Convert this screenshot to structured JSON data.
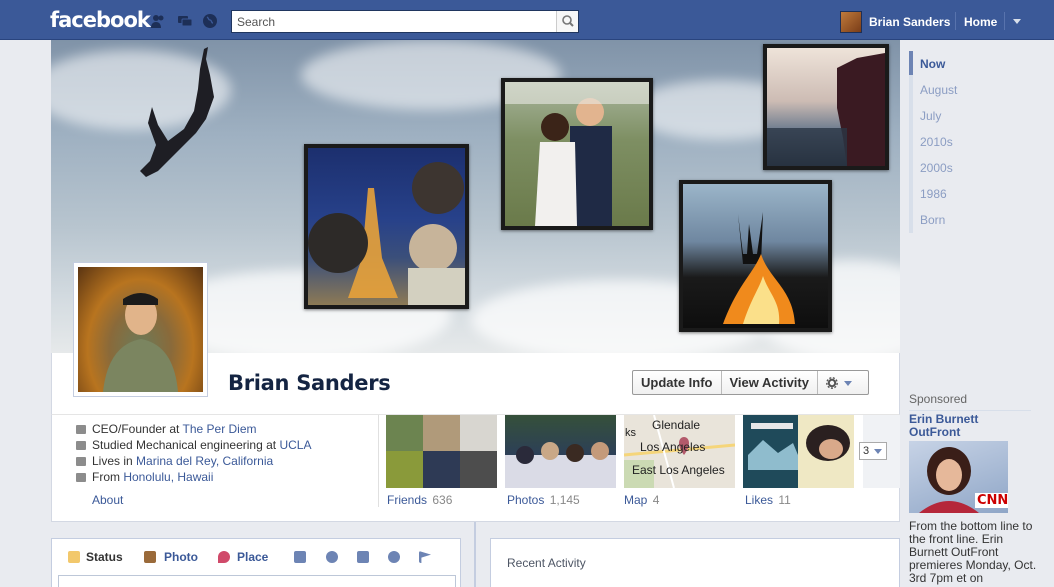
{
  "topbar": {
    "logo": "facebook",
    "search_placeholder": "Search",
    "user_name": "Brian Sanders",
    "home_label": "Home"
  },
  "profile": {
    "name": "Brian Sanders",
    "update_info_label": "Update Info",
    "view_activity_label": "View Activity"
  },
  "about": {
    "work_prefix": "CEO/Founder at ",
    "work_link": "The Per Diem",
    "study_prefix": "Studied Mechanical engineering at ",
    "study_link": "UCLA",
    "lives_prefix": "Lives in ",
    "lives_link": "Marina del Rey, California",
    "from_prefix": "From ",
    "from_link": "Honolulu, Hawaii",
    "about_link": "About"
  },
  "tiles": [
    {
      "label": "Friends",
      "count": "636"
    },
    {
      "label": "Photos",
      "count": "1,145"
    },
    {
      "label": "Map",
      "count": "4"
    },
    {
      "label": "Likes",
      "count": "11"
    }
  ],
  "map_tile": {
    "place1": "Glendale",
    "place2": "Los Angeles",
    "place3": "East Los Angeles",
    "edge_text": "ks"
  },
  "more_count": "3",
  "composer": {
    "status": "Status",
    "photo": "Photo",
    "place": "Place"
  },
  "recent": {
    "title": "Recent Activity"
  },
  "timeline_nav": [
    "Now",
    "August",
    "July",
    "2010s",
    "2000s",
    "1986",
    "Born"
  ],
  "sponsored": {
    "label": "Sponsored",
    "title": "Erin Burnett OutFront",
    "brand": "CNN",
    "text": "From the bottom line to the front line. Erin Burnett OutFront premieres Monday, Oct. 3rd 7pm et on"
  },
  "colors": {
    "brand_blue": "#3b5998",
    "link": "#3b5998"
  }
}
